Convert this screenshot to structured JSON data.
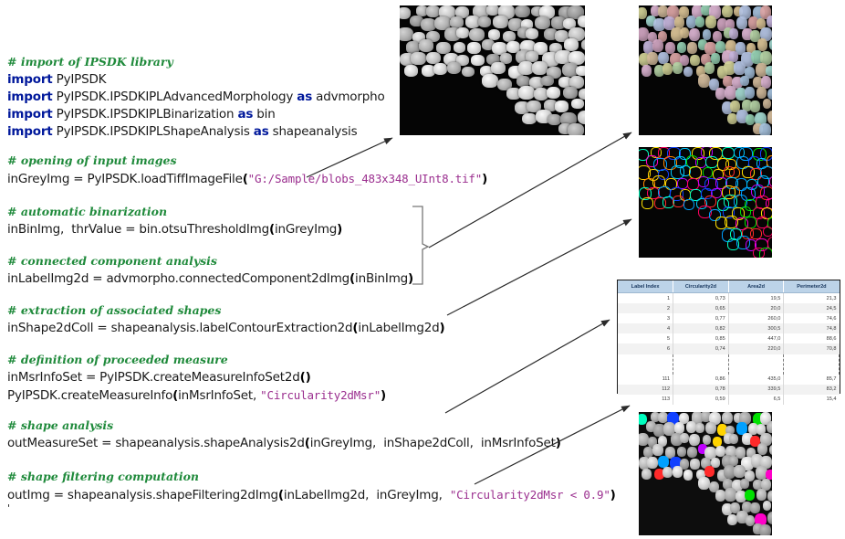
{
  "code": {
    "blocks": [
      {
        "id": "imports",
        "comment": "# import of IPSDK library",
        "lines": [
          {
            "kw": "import",
            "rest": " PyIPSDK"
          },
          {
            "kw": "import",
            "rest": " PyIPSDK.IPSDKIPLAdvancedMorphology ",
            "kw2": "as",
            "rest2": " advmorpho"
          },
          {
            "kw": "import",
            "rest": " PyIPSDK.IPSDKIPLBinarization ",
            "kw2": "as",
            "rest2": " bin"
          },
          {
            "kw": "import",
            "rest": " PyIPSDK.IPSDKIPLShapeAnalysis ",
            "kw2": "as",
            "rest2": " shapeanalysis"
          }
        ]
      },
      {
        "id": "open",
        "comment": "# opening of input images",
        "code_pre": "inGreyImg = PyIPSDK.loadTiffImageFile",
        "paren_open": "(",
        "string": "\"G:/Sample/blobs_483x348_UInt8.tif\"",
        "paren_close": ")"
      },
      {
        "id": "binarize",
        "comment": "# automatic binarization",
        "code": "inBinImg,  thrValue = bin.otsuThresholdImg",
        "paren_open": "(",
        "arg": "inGreyImg",
        "paren_close": ")"
      },
      {
        "id": "connected",
        "comment": "# connected component analysis",
        "code": "inLabelImg2d = advmorpho.connectedComponent2dImg",
        "paren_open": "(",
        "arg": "inBinImg",
        "paren_close": ")"
      },
      {
        "id": "shapes",
        "comment": "# extraction of associated shapes",
        "code": "inShape2dColl = shapeanalysis.labelContourExtraction2d",
        "paren_open": "(",
        "arg": "inLabelImg2d",
        "paren_close": ")"
      },
      {
        "id": "measure",
        "comment": "# definition of proceeded measure",
        "line1_code": "inMsrInfoSet = PyIPSDK.createMeasureInfoSet2d",
        "line1_parens": "()",
        "line2_code": "PyIPSDK.createMeasureInfo",
        "line2_paren_open": "(",
        "line2_arg": "inMsrInfoSet, ",
        "line2_string": "\"Circularity2dMsr\"",
        "line2_paren_close": ")"
      },
      {
        "id": "analysis",
        "comment": "# shape analysis",
        "code": "outMeasureSet = shapeanalysis.shapeAnalysis2d",
        "paren_open": "(",
        "arg": "inGreyImg,  inShape2dColl,  inMsrInfoSet",
        "paren_close": ")"
      },
      {
        "id": "filtering",
        "comment": "# shape filtering computation",
        "code": "outImg = shapeanalysis.shapeFiltering2dImg",
        "paren_open": "(",
        "arg": "inLabelImg2d,  inGreyImg,  ",
        "string": "\"Circularity2dMsr < 0.9\"",
        "paren_close": ")",
        "trailing": "'"
      }
    ]
  },
  "images": {
    "input_grey": {
      "label": "blobs-greyscale-input-image"
    },
    "labels_color": {
      "label": "connected-component-label-image"
    },
    "contours": {
      "label": "extracted-contours-image"
    },
    "filtered": {
      "label": "shape-filtering-result-image"
    }
  },
  "table": {
    "headers": [
      "Label Index",
      "Circularity2d",
      "Area2d",
      "Perimeter2d"
    ],
    "rows_top": [
      [
        "1",
        "0,73",
        "19,5",
        "21,3"
      ],
      [
        "2",
        "0,65",
        "20,0",
        "24,5"
      ],
      [
        "3",
        "0,77",
        "260,0",
        "74,6"
      ],
      [
        "4",
        "0,82",
        "300,5",
        "74,8"
      ],
      [
        "5",
        "0,85",
        "447,0",
        "88,6"
      ],
      [
        "6",
        "0,74",
        "220,0",
        "70,8"
      ]
    ],
    "rows_bottom": [
      [
        "111",
        "0,86",
        "435,0",
        "85,7"
      ],
      [
        "112",
        "0,78",
        "339,5",
        "83,2"
      ],
      [
        "113",
        "0,59",
        "6,5",
        "15,4"
      ]
    ]
  },
  "colors": {
    "comment": "#1f8a3b",
    "keyword": "#00189b",
    "string": "#9b2f8f",
    "table_header_bg": "#bcd3e8",
    "table_header_text": "#17365d",
    "arrow": "#2a2a2a"
  }
}
